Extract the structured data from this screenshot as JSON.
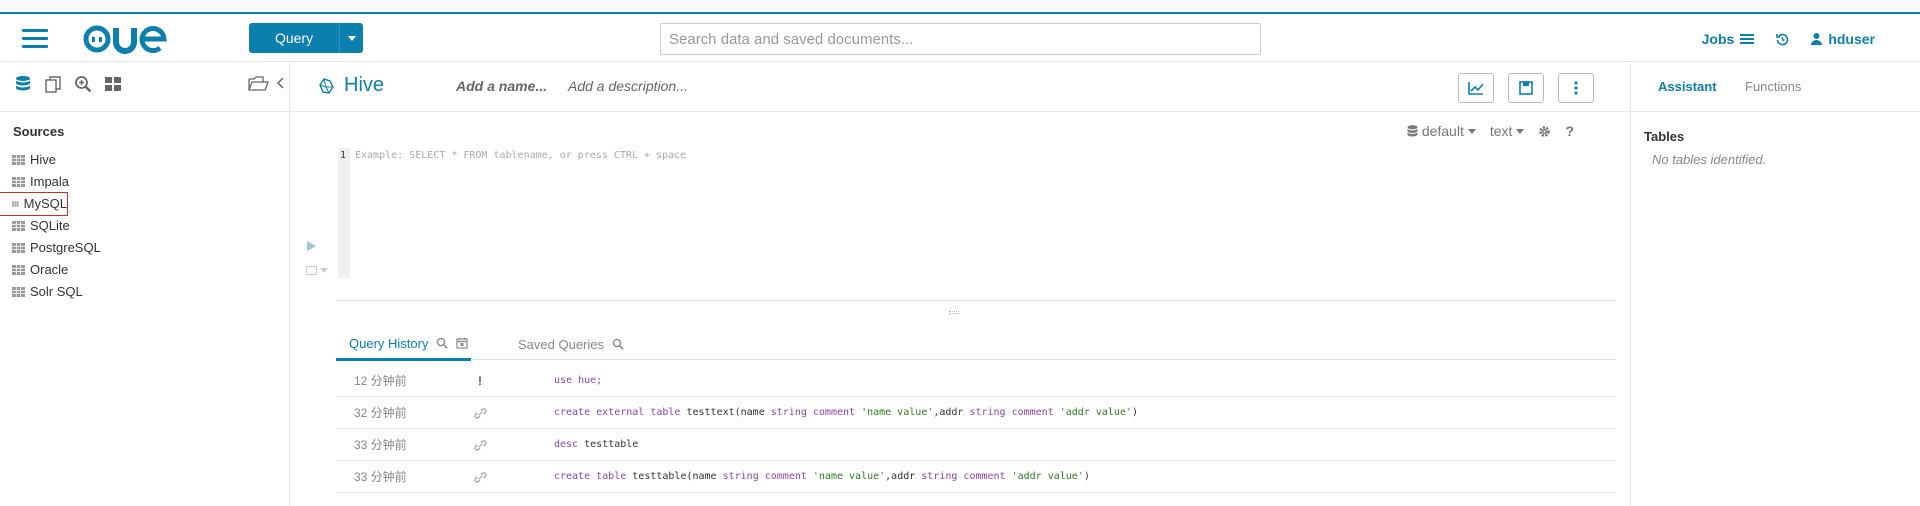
{
  "header": {
    "query_label": "Query",
    "search_placeholder": "Search data and saved documents...",
    "jobs_label": "Jobs",
    "user_label": "hduser",
    "brand_color": "#0b7fad"
  },
  "left": {
    "sources_title": "Sources",
    "sources": [
      "Hive",
      "Impala",
      "MySQL",
      "SQLite",
      "PostgreSQL",
      "Oracle",
      "Solr SQL"
    ],
    "selected_source": "MySQL"
  },
  "editor": {
    "title": "Hive",
    "add_name": "Add a name...",
    "add_description": "Add a description...",
    "database": "default",
    "format": "text",
    "help": "?",
    "line_number": "1",
    "placeholder": "Example: SELECT * FROM tablename, or press CTRL + space"
  },
  "tabs": {
    "history": "Query History",
    "saved": "Saved Queries"
  },
  "history": [
    {
      "time": "12 分钟前",
      "status": "!"
    },
    {
      "time": "32 分钟前",
      "status": "link"
    },
    {
      "time": "33 分钟前",
      "status": "link"
    },
    {
      "time": "33 分钟前",
      "status": "link"
    }
  ],
  "queries": {
    "q1": "use hue;",
    "q2_a": "create external table ",
    "q2_b": "testtext(name ",
    "q2_c": "string comment ",
    "q2_d": "'name value'",
    "q2_e": ",addr ",
    "q2_f": "string comment ",
    "q2_g": "'addr value'",
    "q2_h": ")",
    "q3_a": "desc ",
    "q3_b": "testtable",
    "q4_a": "create table ",
    "q4_b": "testtable(name ",
    "q4_c": "string comment ",
    "q4_d": "'name value'",
    "q4_e": ",addr ",
    "q4_f": "string comment ",
    "q4_g": "'addr value'",
    "q4_h": ")"
  },
  "assistant": {
    "tab_assistant": "Assistant",
    "tab_functions": "Functions",
    "tables_title": "Tables",
    "no_tables": "No tables identified."
  }
}
